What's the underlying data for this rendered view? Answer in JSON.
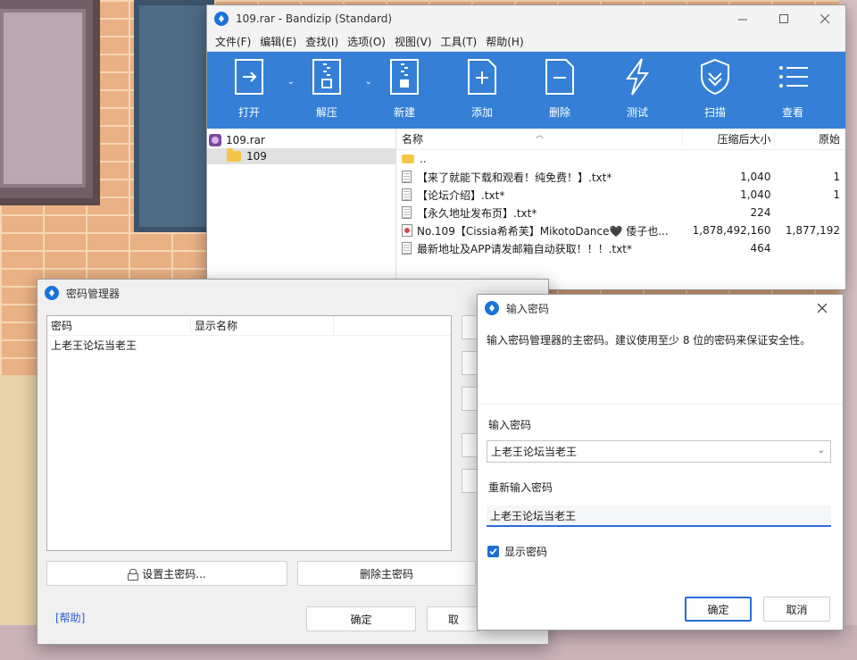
{
  "bandizip": {
    "title": "109.rar - Bandizip (Standard)",
    "menu": [
      "文件(F)",
      "编辑(E)",
      "查找(I)",
      "选项(O)",
      "视图(V)",
      "工具(T)",
      "帮助(H)"
    ],
    "toolbar": [
      {
        "label": "打开",
        "icon": "open-icon",
        "dropdown": true
      },
      {
        "label": "解压",
        "icon": "extract-icon",
        "dropdown": true
      },
      {
        "label": "新建",
        "icon": "new-archive-icon",
        "dropdown": false
      },
      {
        "label": "添加",
        "icon": "add-icon",
        "dropdown": false
      },
      {
        "label": "删除",
        "icon": "delete-icon",
        "dropdown": false
      },
      {
        "label": "测试",
        "icon": "test-icon",
        "dropdown": false
      },
      {
        "label": "扫描",
        "icon": "scan-shield-icon",
        "dropdown": false
      },
      {
        "label": "查看",
        "icon": "view-list-icon",
        "dropdown": false
      }
    ],
    "tree": {
      "root": "109.rar",
      "child": "109"
    },
    "columns": {
      "name": "名称",
      "compressed": "压缩后大小",
      "original": "原始"
    },
    "files": [
      {
        "name": "..",
        "icon": "folder",
        "compressed": "",
        "original": ""
      },
      {
        "name": "【来了就能下载和观看！纯免费！】.txt*",
        "icon": "txt",
        "compressed": "1,040",
        "original": "1"
      },
      {
        "name": "【论坛介绍】.txt*",
        "icon": "txt",
        "compressed": "1,040",
        "original": "1"
      },
      {
        "name": "【永久地址发布页】.txt*",
        "icon": "txt",
        "compressed": "224",
        "original": ""
      },
      {
        "name": "No.109【Cissia希希芙】MikotoDance🖤 倭子也...",
        "icon": "video",
        "compressed": "1,878,492,160",
        "original": "1,877,192"
      },
      {
        "name": "最新地址及APP请发邮箱自动获取！！！.txt*",
        "icon": "txt",
        "compressed": "464",
        "original": ""
      }
    ]
  },
  "pwmgr": {
    "title": "密码管理器",
    "col_password": "密码",
    "col_display_name": "显示名称",
    "rows": [
      {
        "password": "上老王论坛当老王",
        "display": ""
      }
    ],
    "set_master": "设置主密码...",
    "delete_master": "删除主密码",
    "help": "[帮助]",
    "ok": "确定",
    "cancel": "取"
  },
  "pwinput": {
    "title": "输入密码",
    "description": "输入密码管理器的主密码。建议使用至少 8 位的密码来保证安全性。",
    "label_password": "输入密码",
    "password_value": "上老王论坛当老王",
    "label_confirm": "重新输入密码",
    "confirm_value": "上老王论坛当老王",
    "show_password": "显示密码",
    "show_password_checked": true,
    "ok": "确定",
    "cancel": "取消"
  },
  "colors": {
    "toolbar_blue": "#3580d6",
    "accent": "#2a6dd6"
  }
}
